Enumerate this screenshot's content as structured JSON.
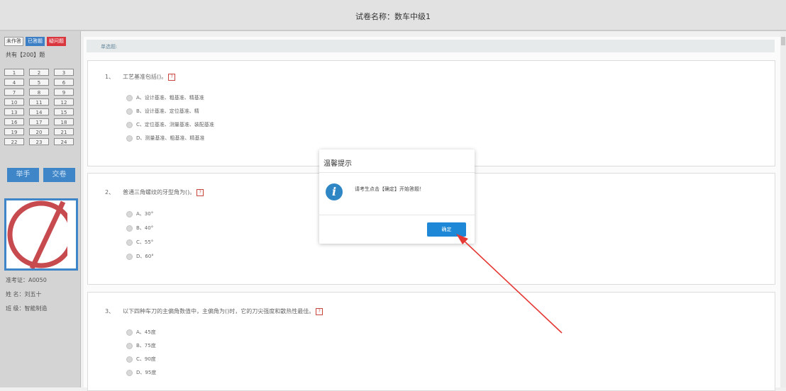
{
  "header": {
    "title": "试卷名称：数车中级1"
  },
  "sidebar": {
    "legend": {
      "undone": "未作答",
      "done": "已答题",
      "doubt": "疑问题"
    },
    "total": "共有【200】题",
    "question_numbers": [
      "1",
      "2",
      "3",
      "4",
      "5",
      "6",
      "7",
      "8",
      "9",
      "10",
      "11",
      "12",
      "13",
      "14",
      "15",
      "16",
      "17",
      "18",
      "19",
      "20",
      "21",
      "22",
      "23",
      "24"
    ],
    "raise_hand": "举手",
    "submit": "交卷",
    "ticket": "准考证：A0050",
    "name": "姓  名：刘五十",
    "class": "班  级：智能制造"
  },
  "main": {
    "section": "单选题:",
    "questions": [
      {
        "num": "1、",
        "text": "工艺基准包括()。",
        "options": [
          "A、设计基准、粗基准、精基准",
          "B、设计基准、定位基准、精",
          "C、定位基准、测量基准、装配基准",
          "D、测量基准、粗基准、精基准"
        ]
      },
      {
        "num": "2、",
        "text": "普通三角螺纹的牙型角为()。",
        "options": [
          "A、30°",
          "B、40°",
          "C、55°",
          "D、60°"
        ]
      },
      {
        "num": "3、",
        "text": "以下四种车刀的主偏角数值中，主偏角为()时，它的刀尖强度和散热性最佳。",
        "options": [
          "A、45度",
          "B、75度",
          "C、90度",
          "D、95度"
        ]
      }
    ]
  },
  "modal": {
    "title": "温馨提示",
    "message": "请考生点击【确定】开始答题！",
    "ok": "确定"
  },
  "colors": {
    "accent": "#1e88d6",
    "sidebar_button": "#3f86c8",
    "doubt": "#d9363e",
    "arrow": "#e53935"
  }
}
